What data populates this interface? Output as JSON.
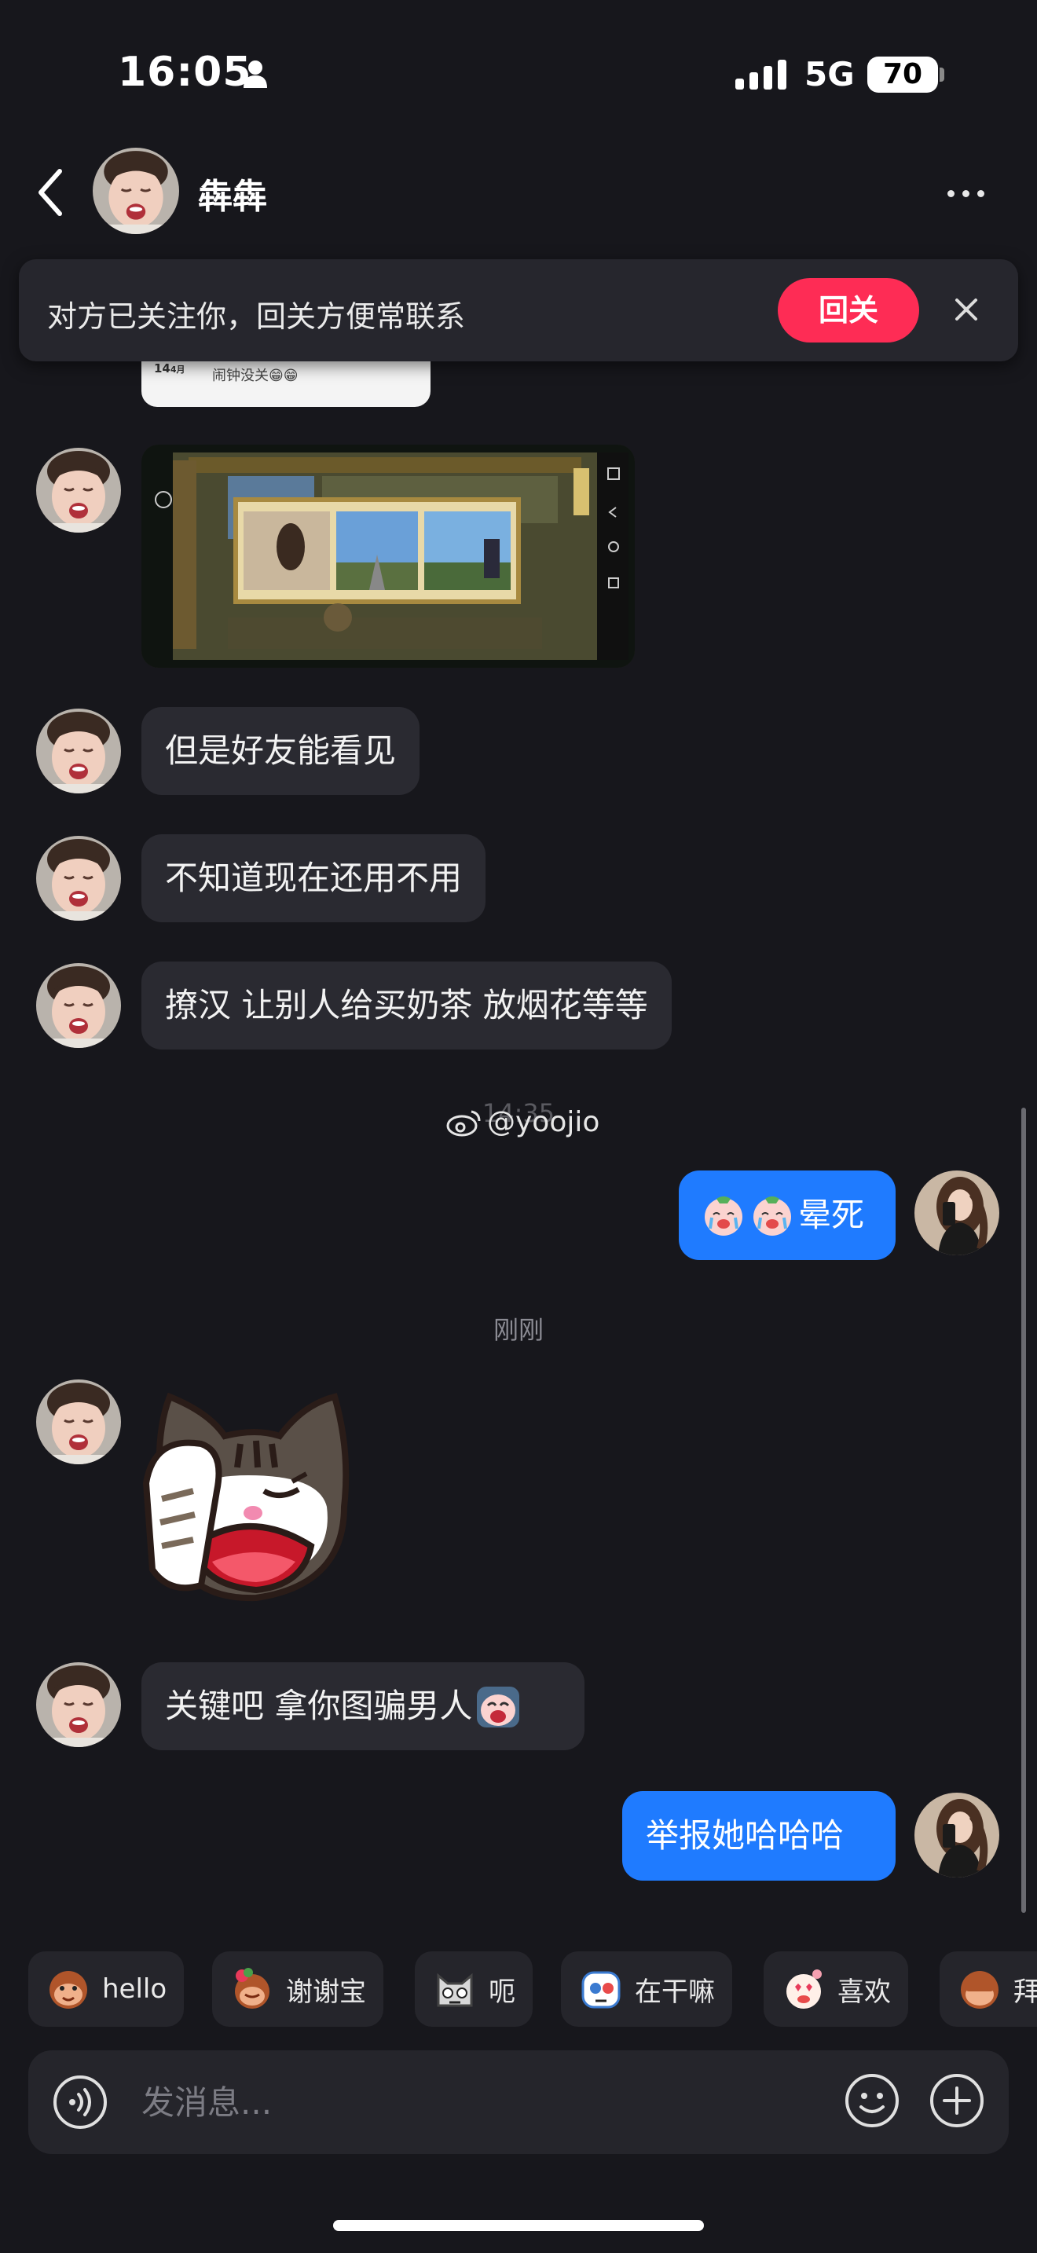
{
  "status_bar": {
    "time": "16:05",
    "network": "5G",
    "battery": "70"
  },
  "header": {
    "contact_name": "犇犇"
  },
  "follow_banner": {
    "text": "对方已关注你，回关方便常联系",
    "button": "回关"
  },
  "clipped_image": {
    "date": "14",
    "date_suffix": "4月",
    "text": "闹钟没关😁😁"
  },
  "messages": {
    "m1": "但是好友能看见",
    "m2": "不知道现在还用不用",
    "m3": "撩汉 让别人给买奶茶 放烟花等等",
    "m4": "晕死",
    "m5": "关键吧 拿你图骗男人",
    "m6": "举报她哈哈哈"
  },
  "timestamps": {
    "t1": "14:35",
    "t2": "刚刚"
  },
  "watermark": "@yoojio",
  "quick_replies": [
    {
      "label": "hello",
      "icon": "monkey-emoji-icon"
    },
    {
      "label": "谢谢宝",
      "icon": "monkey-flower-emoji-icon"
    },
    {
      "label": "呃",
      "icon": "cat-emoji-icon"
    },
    {
      "label": "在干嘛",
      "icon": "robot-emoji-icon"
    },
    {
      "label": "喜欢",
      "icon": "hearts-emoji-icon"
    },
    {
      "label": "拜",
      "icon": "monkey-bye-emoji-icon"
    }
  ],
  "input": {
    "placeholder": "发消息..."
  },
  "colors": {
    "background": "#17171c",
    "bubble_incoming": "#2a2a31",
    "bubble_outgoing": "#1f7bff",
    "follow_button": "#fe2c55"
  }
}
